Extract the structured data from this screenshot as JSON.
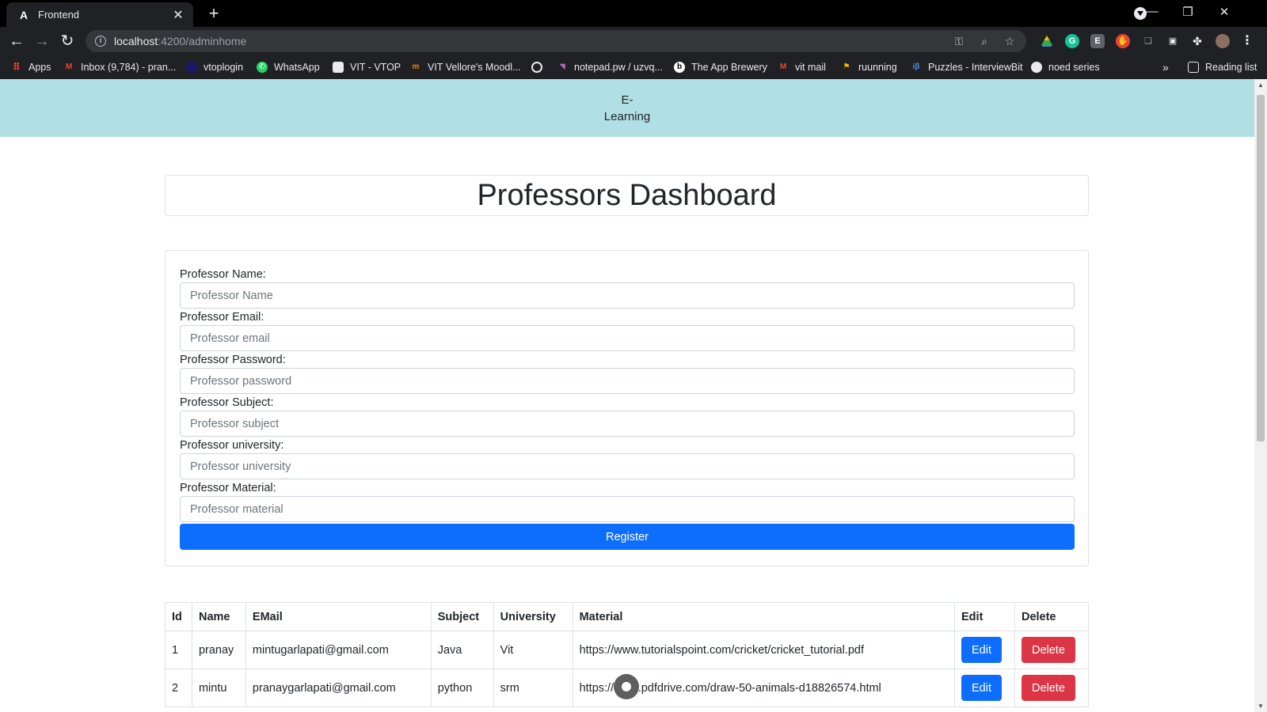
{
  "browser": {
    "tab_title": "Frontend",
    "tab_favicon": "A",
    "url_host": "localhost",
    "url_path": ":4200/adminhome",
    "reading_list": "Reading list"
  },
  "bookmarks": [
    {
      "label": "Apps",
      "icon": "apps-grid-icon",
      "color": "#ea4335"
    },
    {
      "label": "Inbox (9,784) - pran...",
      "icon": "gmail-icon",
      "color": "#ea4335"
    },
    {
      "label": "vtoplogin",
      "icon": "globe-icon",
      "color": "#3c4043"
    },
    {
      "label": "WhatsApp",
      "icon": "whatsapp-icon",
      "color": "#25d366"
    },
    {
      "label": "VIT - VTOP",
      "icon": "page-icon",
      "color": "#9aa0a6"
    },
    {
      "label": "VIT Vellore's Moodl...",
      "icon": "moodle-icon",
      "color": "#f98012"
    },
    {
      "label": "",
      "icon": "chrome-icon",
      "color": "#e8eaed"
    },
    {
      "label": "notepad.pw / uzvq...",
      "icon": "notepad-icon",
      "color": "#b06ab3"
    },
    {
      "label": "The App Brewery",
      "icon": "appbrewery-icon",
      "color": "#fbbc04"
    },
    {
      "label": "vit mail",
      "icon": "gmail-icon",
      "color": "#ea4335"
    },
    {
      "label": "ruunning",
      "icon": "runner-icon",
      "color": "#fbbc04"
    },
    {
      "label": "Puzzles - InterviewBit",
      "icon": "interviewbit-icon",
      "color": "#4a90e2"
    },
    {
      "label": "noed series",
      "icon": "github-icon",
      "color": "#e8eaed"
    }
  ],
  "app": {
    "brand_line1": "E-",
    "brand_line2": "Learning",
    "page_title": "Professors Dashboard"
  },
  "form": {
    "fields": [
      {
        "label": "Professor Name:",
        "placeholder": "Professor Name"
      },
      {
        "label": "Professor Email:",
        "placeholder": "Professor email"
      },
      {
        "label": "Professor Password:",
        "placeholder": "Professor password"
      },
      {
        "label": "Professor Subject:",
        "placeholder": "Professor subject"
      },
      {
        "label": "Professor university:",
        "placeholder": "Professor university"
      },
      {
        "label": "Professor Material:",
        "placeholder": "Professor material"
      }
    ],
    "submit_label": "Register"
  },
  "table": {
    "headers": [
      "Id",
      "Name",
      "EMail",
      "Subject",
      "University",
      "Material",
      "Edit",
      "Delete"
    ],
    "rows": [
      {
        "id": "1",
        "name": "pranay",
        "email": "mintugarlapati@gmail.com",
        "subject": "Java",
        "university": "Vit",
        "material": "https://www.tutorialspoint.com/cricket/cricket_tutorial.pdf",
        "edit": "Edit",
        "delete": "Delete"
      },
      {
        "id": "2",
        "name": "mintu",
        "email": "pranaygarlapati@gmail.com",
        "subject": "python",
        "university": "srm",
        "material": "https://www.pdfdrive.com/draw-50-animals-d18826574.html",
        "edit": "Edit",
        "delete": "Delete"
      }
    ]
  }
}
